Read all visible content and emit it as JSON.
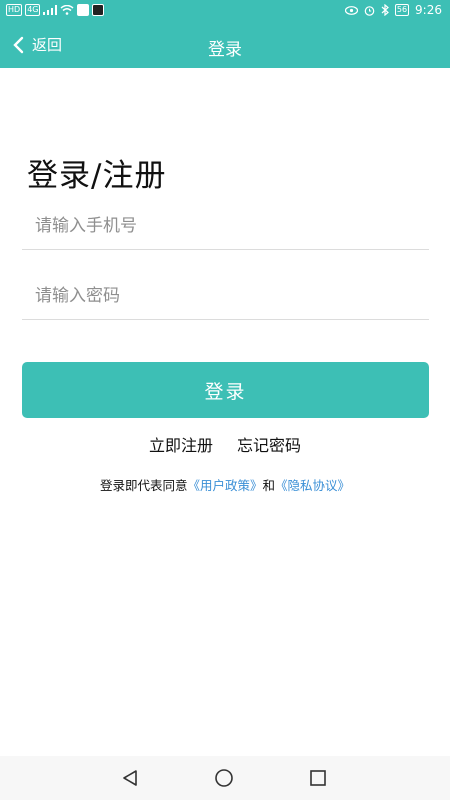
{
  "status_bar": {
    "time": "9:26",
    "network_label": "HD",
    "signal_label": "4G",
    "battery_level": "56"
  },
  "header": {
    "back_label": "返回",
    "title": "登录"
  },
  "form": {
    "heading": "登录/注册",
    "phone_placeholder": "请输入手机号",
    "password_placeholder": "请输入密码",
    "login_button": "登录"
  },
  "links": {
    "register": "立即注册",
    "forgot_password": "忘记密码"
  },
  "agreement": {
    "prefix": "登录即代表同意",
    "user_policy": "《用户政策》",
    "conjunction": "和",
    "privacy_policy": "《隐私协议》"
  },
  "colors": {
    "brand": "#3dbfb5",
    "link": "#3a8fd6"
  },
  "icons": {
    "back": "chevron-left-icon",
    "system_back": "triangle-back-icon",
    "system_home": "circle-home-icon",
    "system_recent": "square-recent-icon"
  }
}
